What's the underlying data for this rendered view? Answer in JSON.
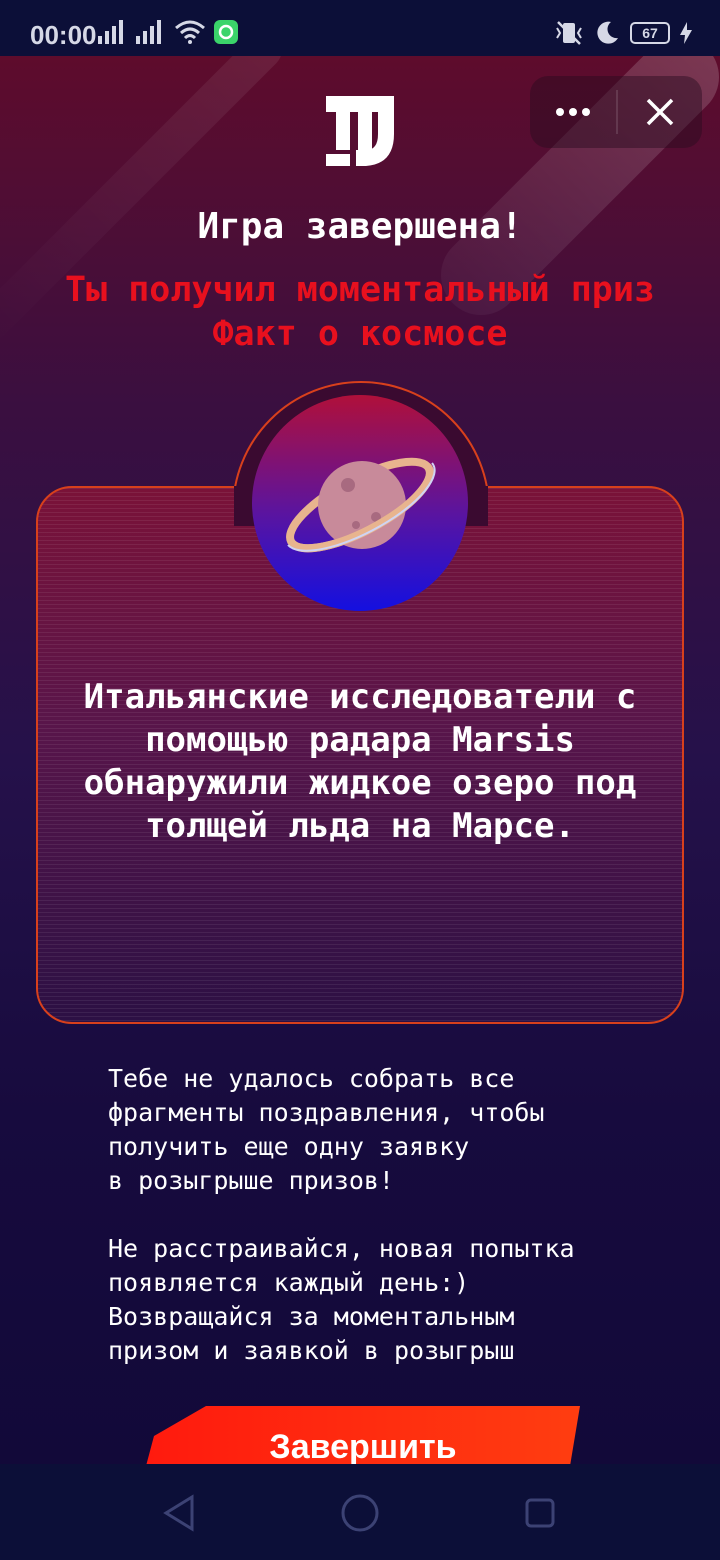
{
  "status_bar": {
    "time": "00:00",
    "battery": "67",
    "icons": [
      "signal-icon",
      "signal-icon",
      "wifi-icon",
      "app-notification-icon",
      "vibrate-off-icon",
      "moon-icon",
      "battery-icon",
      "charging-icon"
    ]
  },
  "header": {
    "logo": "magnit-logo",
    "more_icon": "more-icon",
    "close_icon": "close-icon"
  },
  "main": {
    "title": "Игра завершена!",
    "subtitle_line1": "Ты получил моментальный приз",
    "subtitle_line2": "Факт о космосе",
    "fact_text": "Итальянские исследователи с помощью радара Marsis обнаружили жидкое озеро под толщей льда на Марсе.",
    "info_paragraph1": "Тебе не удалось собрать все\nфрагменты поздравления, чтобы\nполучить еще одну заявку\nв розыгрыше призов!",
    "info_paragraph2": "Не расстраивайся, новая попытка\nпоявляется каждый день:)\nВозвращайся за моментальным\nпризом и заявкой в розыгрыш",
    "finish_button": "Завершить"
  },
  "colors": {
    "accent_red": "#e8101e",
    "button_orange": "#ff3a10",
    "card_border": "#d8401c"
  },
  "nav_bar": {
    "back_icon": "back-icon",
    "home_icon": "home-icon",
    "recents_icon": "recents-icon"
  }
}
